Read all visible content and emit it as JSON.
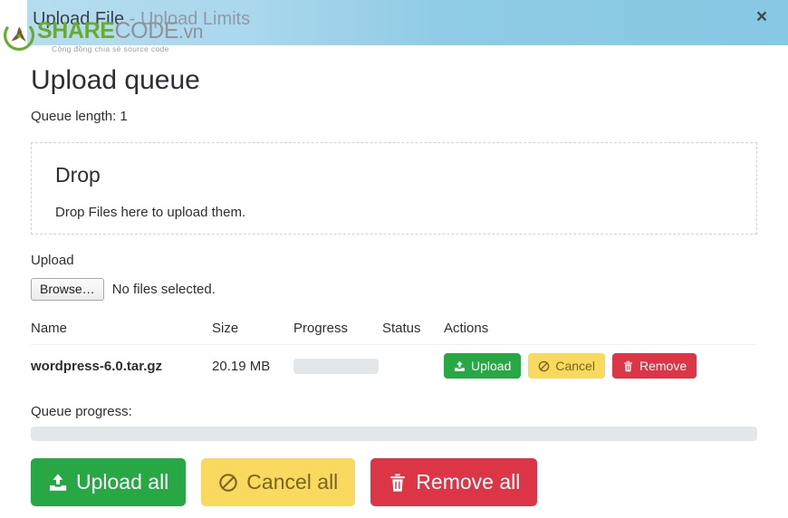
{
  "window": {
    "title_main": "Upload File",
    "title_sep": " - ",
    "title_sub": "Upload Limits",
    "close_label": "×",
    "close_icon": "close-icon"
  },
  "brand": {
    "name_strong": "SHARE",
    "name_light": "CODE",
    "tld": ".vn",
    "tagline": "Cộng đồng chia sẻ source code",
    "logo_icon": "recycle-leaf-logo-icon"
  },
  "page": {
    "heading": "Upload queue",
    "queue_length": "Queue length: 1"
  },
  "dropzone": {
    "heading": "Drop",
    "text": "Drop Files here to upload them."
  },
  "upload": {
    "label": "Upload",
    "browse_label": "Browse…",
    "no_files_text": "No files selected."
  },
  "table": {
    "headers": [
      "Name",
      "Size",
      "Progress",
      "Status",
      "Actions"
    ],
    "rows": [
      {
        "name": "wordpress-6.0.tar.gz",
        "size": "20.19 MB",
        "progress_percent": 0,
        "status": "",
        "actions": [
          {
            "label": "Upload",
            "icon": "upload-icon",
            "style": "green"
          },
          {
            "label": "Cancel",
            "icon": "ban-icon",
            "style": "yellow"
          },
          {
            "label": "Remove",
            "icon": "trash-icon",
            "style": "red"
          }
        ]
      }
    ]
  },
  "queue_progress": {
    "label": "Queue progress:",
    "percent": 0
  },
  "bottom_actions": [
    {
      "label": "Upload all",
      "icon": "upload-icon",
      "style": "green"
    },
    {
      "label": "Cancel all",
      "icon": "ban-icon",
      "style": "yellow"
    },
    {
      "label": "Remove all",
      "icon": "trash-icon",
      "style": "red"
    }
  ],
  "colors": {
    "green": "#28a745",
    "yellow": "#f9da5f",
    "red": "#dc3545",
    "header_blue": "#8fcbe5",
    "progress_track": "#e3e7ea",
    "brand_green": "#6aab2e"
  }
}
